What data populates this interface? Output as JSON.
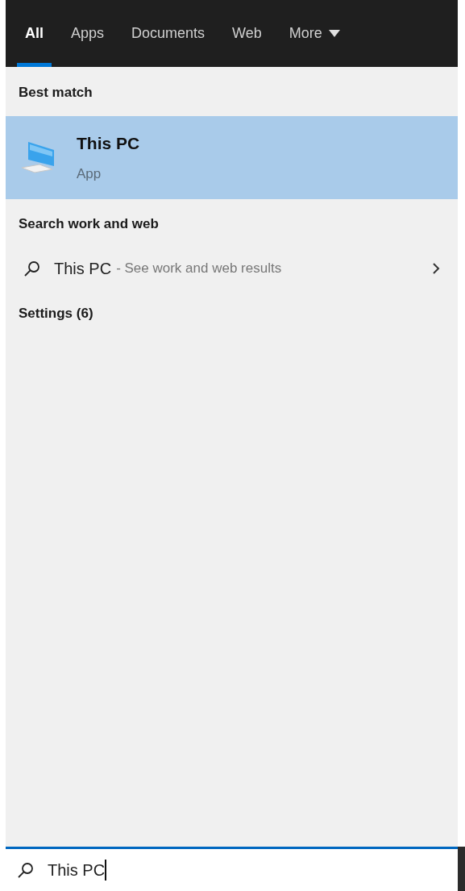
{
  "tabs": [
    {
      "label": "All",
      "selected": true
    },
    {
      "label": "Apps",
      "selected": false
    },
    {
      "label": "Documents",
      "selected": false
    },
    {
      "label": "Web",
      "selected": false
    },
    {
      "label": "More",
      "selected": false,
      "kind": "dropdown"
    }
  ],
  "best_match": {
    "heading": "Best match",
    "result": {
      "title": "This PC",
      "subtitle": "App",
      "selected": true
    }
  },
  "search_web": {
    "heading": "Search work and web",
    "query": "This PC",
    "hint": "- See work and web results"
  },
  "settings": {
    "heading": "Settings (6)"
  },
  "search_box": {
    "value": "This PC"
  }
}
